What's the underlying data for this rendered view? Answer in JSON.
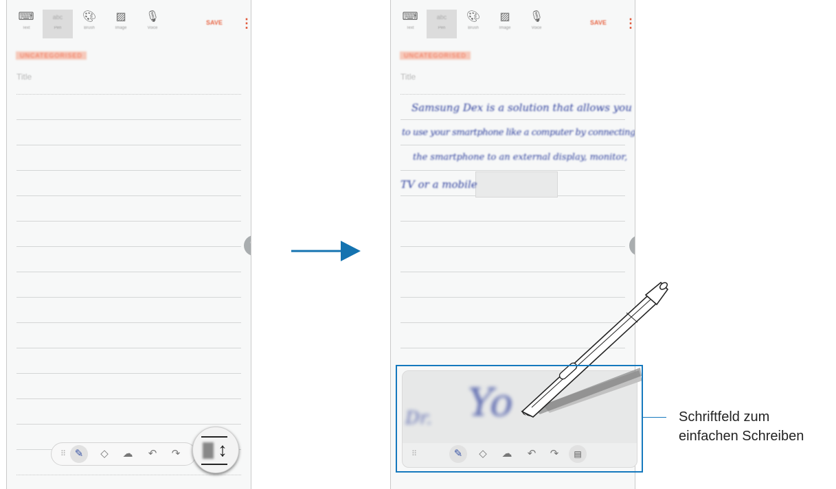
{
  "toolbar": {
    "tools": [
      {
        "id": "text",
        "label": "Text",
        "icon": "keyboard-icon"
      },
      {
        "id": "pen",
        "label": "Pen",
        "icon": "pen-mode-icon"
      },
      {
        "id": "brush",
        "label": "Brush",
        "icon": "palette-icon"
      },
      {
        "id": "image",
        "label": "Image",
        "icon": "image-icon"
      },
      {
        "id": "voice",
        "label": "Voice",
        "icon": "microphone-icon"
      }
    ],
    "save_label": "SAVE"
  },
  "note": {
    "category": "UNCATEGORISED",
    "title_placeholder": "Title",
    "handwriting_lines": [
      "Samsung Dex is a solution that allows you",
      "to use your smartphone like a computer by connecting",
      "the smartphone to an external display, monitor,",
      "TV or a mobile"
    ],
    "pad_ink": [
      "Yo",
      "Dr."
    ]
  },
  "pen_toolbar": {
    "tools": [
      "grip-icon",
      "pen-icon",
      "eraser-icon",
      "lasso-icon",
      "undo-icon",
      "redo-icon",
      "writing-pad-icon"
    ]
  },
  "callout": {
    "line1": "Schriftfeld zum",
    "line2": "einfachen Schreiben"
  },
  "colors": {
    "accent": "#e86a4a",
    "callout": "#1478bd",
    "arrow": "#1473b0",
    "ink": "#2c3e9c"
  }
}
